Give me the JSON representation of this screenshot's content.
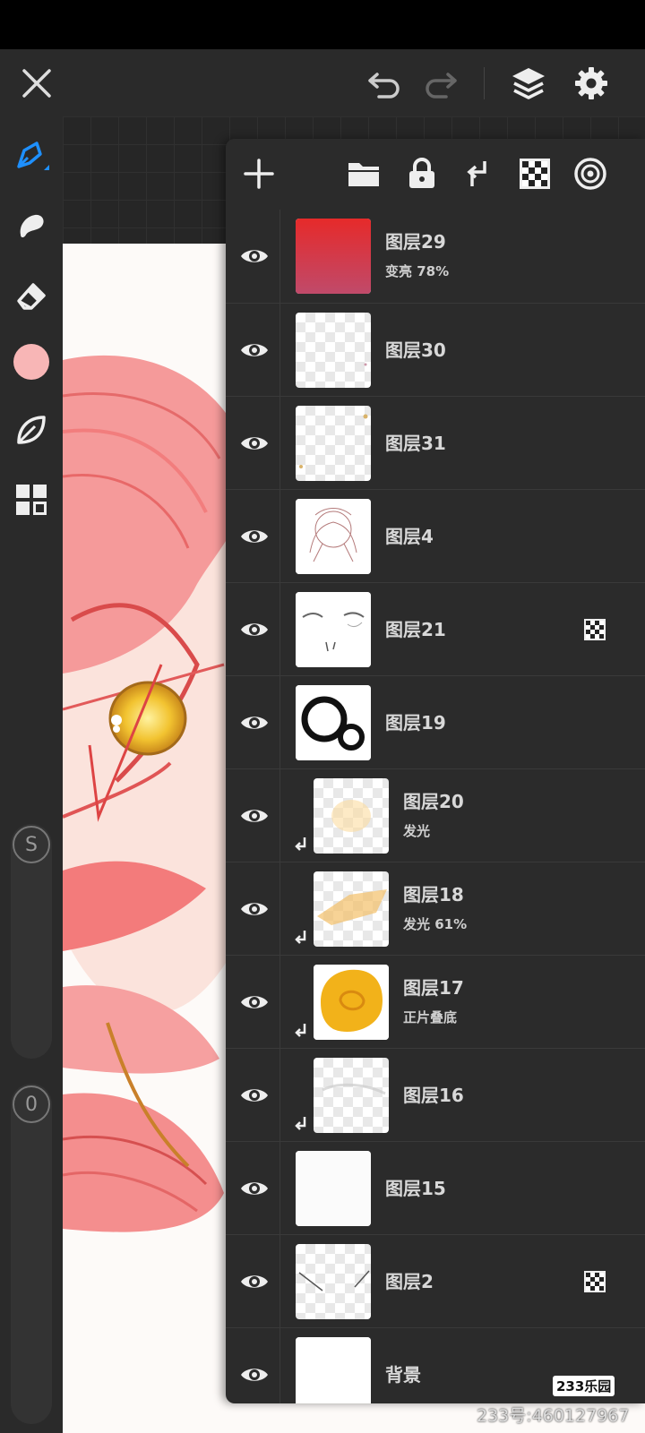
{
  "app": {
    "accent": "#1e90ff",
    "brush_color": "#f8b6b6"
  },
  "topbar": {
    "icons": [
      "close-icon",
      "undo-icon",
      "redo-icon",
      "layers-icon",
      "settings-icon"
    ]
  },
  "toolbar": {
    "tools": [
      "brush-icon",
      "smudge-icon",
      "eraser-icon",
      "color-swatch",
      "leaf-icon",
      "menu-grid-icon"
    ],
    "size_label": "S",
    "opacity_label": "0"
  },
  "layer_panel": {
    "toolbar_icons": [
      "add-layer-icon",
      "folder-icon",
      "lock-icon",
      "clip-icon",
      "transparency-icon",
      "reference-icon"
    ],
    "layers": [
      {
        "name": "图层29",
        "mode": "变亮   78%",
        "clipped": false,
        "alpha_lock": false
      },
      {
        "name": "图层30",
        "mode": "",
        "clipped": false,
        "alpha_lock": false
      },
      {
        "name": "图层31",
        "mode": "",
        "clipped": false,
        "alpha_lock": false
      },
      {
        "name": "图层4",
        "mode": "",
        "clipped": false,
        "alpha_lock": false
      },
      {
        "name": "图层21",
        "mode": "",
        "clipped": false,
        "alpha_lock": true
      },
      {
        "name": "图层19",
        "mode": "",
        "clipped": false,
        "alpha_lock": false
      },
      {
        "name": "图层20",
        "mode": "发光",
        "clipped": true,
        "alpha_lock": false
      },
      {
        "name": "图层18",
        "mode": "发光   61%",
        "clipped": true,
        "alpha_lock": false
      },
      {
        "name": "图层17",
        "mode": "正片叠底",
        "clipped": true,
        "alpha_lock": false
      },
      {
        "name": "图层16",
        "mode": "",
        "clipped": true,
        "alpha_lock": false
      },
      {
        "name": "图层15",
        "mode": "",
        "clipped": false,
        "alpha_lock": false
      },
      {
        "name": "图层2",
        "mode": "",
        "clipped": false,
        "alpha_lock": true
      },
      {
        "name": "背景",
        "mode": "",
        "clipped": false,
        "alpha_lock": false
      }
    ]
  },
  "watermark": {
    "text": "233号:460127967",
    "logo": "233乐园"
  }
}
